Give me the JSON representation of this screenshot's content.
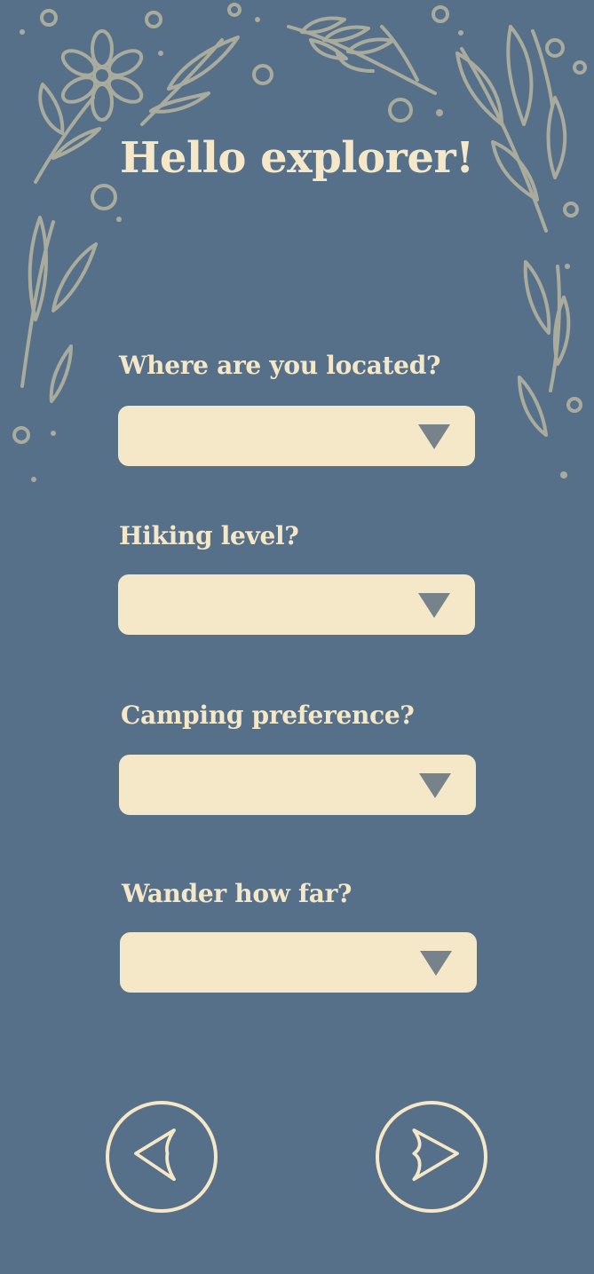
{
  "colors": {
    "background": "#57708a",
    "cream": "#f5e8c8",
    "decoration": "#a9ab9d",
    "caret": "#77828a"
  },
  "header": {
    "title": "Hello explorer!"
  },
  "form": {
    "questions": [
      {
        "label": "Where are you located?",
        "value": ""
      },
      {
        "label": "Hiking level?",
        "value": ""
      },
      {
        "label": "Camping preference?",
        "value": ""
      },
      {
        "label": "Wander how far?",
        "value": ""
      }
    ]
  },
  "navigation": {
    "back_icon": "back-arrow-icon",
    "next_icon": "forward-arrow-icon"
  }
}
